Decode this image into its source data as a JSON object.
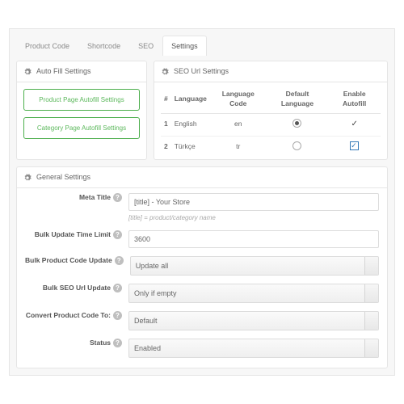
{
  "tabs": {
    "items": [
      "Product Code",
      "Shortcode",
      "SEO",
      "Settings"
    ],
    "active": 3
  },
  "autofill": {
    "title": "Auto Fill Settings",
    "btn_product": "Product Page Autofill Settings",
    "btn_category": "Category Page Autofill Settings"
  },
  "seourl": {
    "title": "SEO Url Settings",
    "cols": {
      "n": "#",
      "lang": "Language",
      "code": "Language Code",
      "def": "Default Language",
      "auto": "Enable Autofill"
    },
    "rows": [
      {
        "n": "1",
        "lang": "English",
        "code": "en",
        "def": true,
        "auto_mode": "check"
      },
      {
        "n": "2",
        "lang": "Türkçe",
        "code": "tr",
        "def": false,
        "auto_mode": "box-on"
      }
    ]
  },
  "general": {
    "title": "General Settings",
    "meta_title": {
      "label": "Meta Title",
      "value": "[title] - Your Store",
      "hint": "[title] = product/category name"
    },
    "bulk_limit": {
      "label": "Bulk Update Time Limit",
      "value": "3600"
    },
    "bulk_code": {
      "label": "Bulk Product Code Update",
      "value": "Update all"
    },
    "bulk_seo": {
      "label": "Bulk SEO Url Update",
      "value": "Only if empty"
    },
    "convert": {
      "label": "Convert Product Code To:",
      "value": "Default"
    },
    "status": {
      "label": "Status",
      "value": "Enabled"
    }
  }
}
